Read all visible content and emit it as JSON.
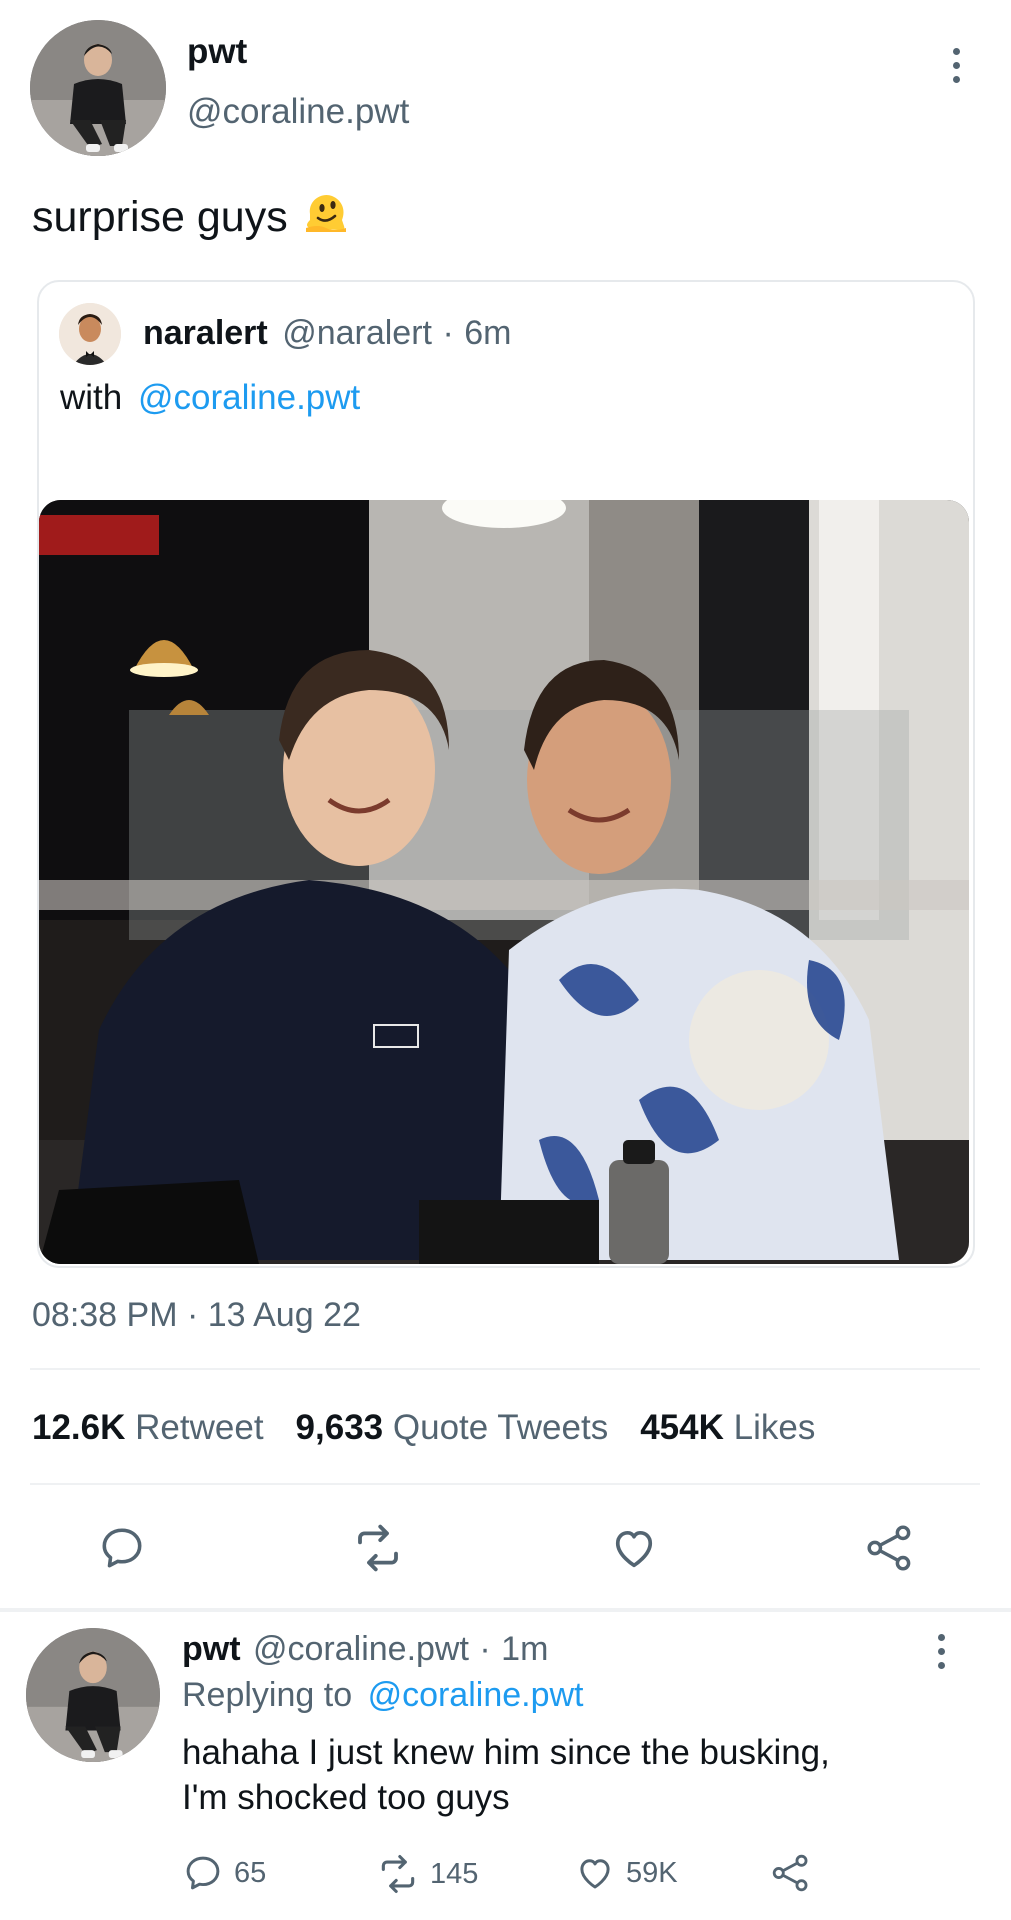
{
  "main_tweet": {
    "display_name": "pwt",
    "handle": "@coraline.pwt",
    "text": "surprise guys",
    "emoji": "melting-face-emoji",
    "timestamp": "08:38 PM · 13 Aug 22"
  },
  "quoted_tweet": {
    "display_name": "naralert",
    "handle": "@naralert",
    "separator": "·",
    "time": "6m",
    "text_prefix": "with",
    "mention": "@coraline.pwt"
  },
  "stats": {
    "retweets_count": "12.6K",
    "retweets_label": "Retweet",
    "quotes_count": "9,633",
    "quotes_label": "Quote Tweets",
    "likes_count": "454K",
    "likes_label": "Likes"
  },
  "actions": [
    "reply-icon",
    "retweet-icon",
    "like-icon",
    "share-icon"
  ],
  "reply": {
    "display_name": "pwt",
    "handle": "@coraline.pwt",
    "separator": "·",
    "time": "1m",
    "replying_prefix": "Replying to",
    "replying_to": "@coraline.pwt",
    "text_line1": "hahaha I just knew him since the busking,",
    "text_line2": "I'm shocked too guys",
    "reply_count": "65",
    "retweet_count": "145",
    "like_count": "59K"
  },
  "colors": {
    "accent": "#1d9bf0",
    "secondary_text": "#536471",
    "primary_text": "#0f1419",
    "divider": "#eff1f3"
  }
}
